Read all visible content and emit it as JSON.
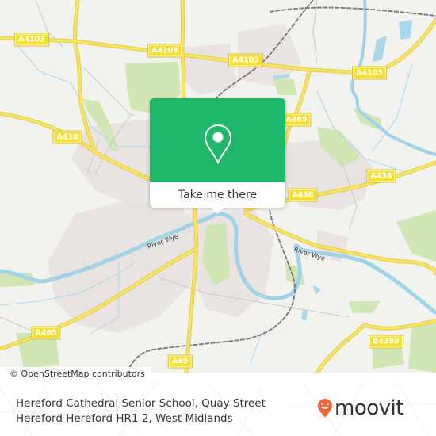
{
  "map": {
    "road_labels": [
      {
        "id": "a4103-west",
        "text": "A4103"
      },
      {
        "id": "a4103-center",
        "text": "A4103"
      },
      {
        "id": "a4103-east",
        "text": "A4103"
      },
      {
        "id": "a4103-center2",
        "text": "A4103"
      },
      {
        "id": "a4103-far-east",
        "text": "A4103"
      },
      {
        "id": "a438-west",
        "text": "A438"
      },
      {
        "id": "a438-edge",
        "text": "A438"
      },
      {
        "id": "a465-north",
        "text": "A465"
      },
      {
        "id": "a438-east",
        "text": "A438"
      },
      {
        "id": "a438-center",
        "text": "A438"
      },
      {
        "id": "a465-south",
        "text": "A465"
      },
      {
        "id": "a49",
        "text": "A49"
      },
      {
        "id": "b4399",
        "text": "B4399"
      }
    ],
    "river_labels": [
      {
        "id": "river-wye-west",
        "text": "River Wye"
      },
      {
        "id": "river-wye-east",
        "text": "River Wye"
      }
    ],
    "colors": {
      "land": "#f2f2ef",
      "urban": "#e8e2e0",
      "park": "#cde6b0",
      "water": "#a8d8ec",
      "river": "#9fd3ea",
      "road": "#f7e26b",
      "road_casing": "#e8cf3d",
      "rail": "#777777"
    }
  },
  "attribution": "© OpenStreetMap contributors",
  "popup": {
    "button_label": "Take me there",
    "accent_color": "#1fb86a"
  },
  "footer": {
    "address_line1": "Hereford Cathedral Senior School, Quay Street",
    "address_line2": "Hereford Hereford HR1 2, West Midlands",
    "brand_name": "moovit",
    "brand_color": "#f0643a"
  }
}
